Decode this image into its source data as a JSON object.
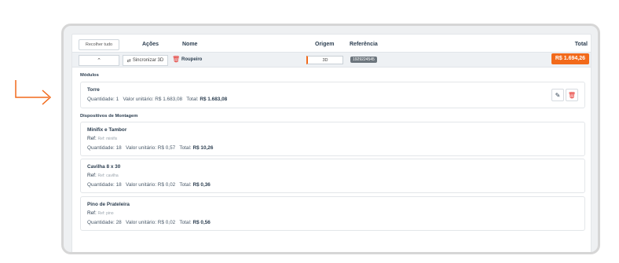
{
  "header": {
    "collapse_label": "Recolher tudo",
    "col_actions": "Ações",
    "col_name": "Nome",
    "col_origin": "Origem",
    "col_reference": "Referência",
    "col_total": "Total"
  },
  "row": {
    "sync_label": "Sincronizar 3D",
    "name": "Roupeiro",
    "origin": "3D",
    "reference": "1929224545",
    "total": "R$ 1.694,26",
    "accent": "#f26a1b"
  },
  "modules": {
    "title": "Módulos",
    "items": [
      {
        "name": "Torre",
        "qty_label": "Quantidade:",
        "qty": "1",
        "unit_label": "Valor unitário:",
        "unit": "R$ 1.683,08",
        "total_label": "Total:",
        "total": "R$ 1.683,08"
      }
    ]
  },
  "devices": {
    "title": "Dispositivos de Montagem",
    "items": [
      {
        "name": "Minifix e Tambor",
        "ref_label": "Ref:",
        "ref": "Ref: minifix",
        "qty_label": "Quantidade:",
        "qty": "18",
        "unit_label": "Valor unitário:",
        "unit": "R$ 0,57",
        "total_label": "Total:",
        "total": "R$ 10,26"
      },
      {
        "name": "Cavilha 8 x 30",
        "ref_label": "Ref:",
        "ref": "Ref: cavilha",
        "qty_label": "Quantidade:",
        "qty": "18",
        "unit_label": "Valor unitário:",
        "unit": "R$ 0,02",
        "total_label": "Total:",
        "total": "R$ 0,36"
      },
      {
        "name": "Pino de Prateleira",
        "ref_label": "Ref:",
        "ref": "Ref: pino",
        "qty_label": "Quantidade:",
        "qty": "28",
        "unit_label": "Valor unitário:",
        "unit": "R$ 0,02",
        "total_label": "Total:",
        "total": "R$ 0,56"
      }
    ]
  },
  "icons": [
    "arrow-return-icon",
    "chevron-up-icon",
    "sync-icon",
    "trash-icon",
    "edit-icon"
  ],
  "colors": {
    "accent": "#f26a1b",
    "danger": "#e52d27",
    "badge": "#6c757d"
  }
}
